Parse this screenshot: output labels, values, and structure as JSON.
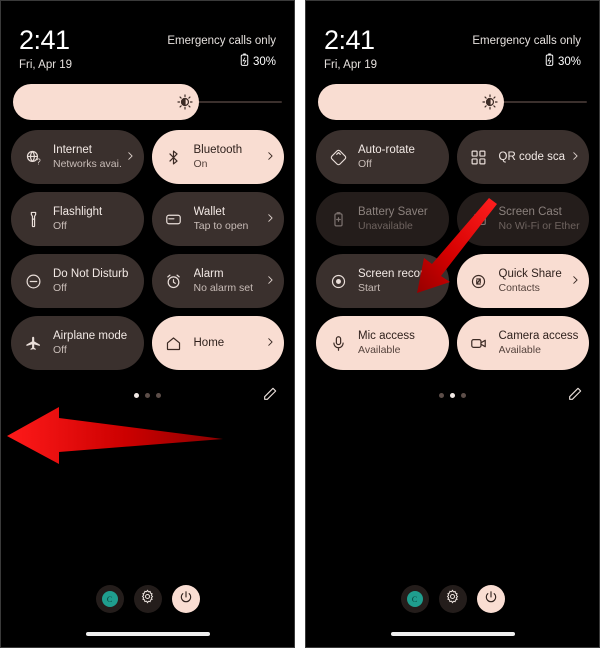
{
  "panels": [
    {
      "id": "panel-left",
      "status": {
        "clock": "2:41",
        "date": "Fri, Apr 19",
        "carrier": "Emergency calls only",
        "battery": "30%",
        "battery_icon": "battery-icon"
      },
      "brightness": {
        "label": "brightness-slider",
        "icon": "brightness-icon",
        "fill_percent": 69
      },
      "tiles": [
        {
          "title": "Internet",
          "sub": "Networks avai..",
          "icon": "globe-question-icon",
          "state": "off",
          "chevron": true
        },
        {
          "title": "Bluetooth",
          "sub": "On",
          "icon": "bluetooth-icon",
          "state": "active",
          "chevron": true
        },
        {
          "title": "Flashlight",
          "sub": "Off",
          "icon": "flashlight-icon",
          "state": "off",
          "chevron": false
        },
        {
          "title": "Wallet",
          "sub": "Tap to open",
          "icon": "wallet-icon",
          "state": "off",
          "chevron": true
        },
        {
          "title": "Do Not Disturb",
          "sub": "Off",
          "icon": "do-not-disturb-icon",
          "state": "off",
          "chevron": false
        },
        {
          "title": "Alarm",
          "sub": "No alarm set",
          "icon": "alarm-icon",
          "state": "off",
          "chevron": true
        },
        {
          "title": "Airplane mode",
          "sub": "Off",
          "icon": "airplane-icon",
          "state": "off",
          "chevron": false
        },
        {
          "title": "Home",
          "sub": "",
          "icon": "home-icon",
          "state": "active",
          "chevron": true
        }
      ],
      "pages": {
        "count": 3,
        "active": 0
      },
      "edit_icon": "pencil-edit-icon",
      "bottom_buttons": [
        {
          "name": "user-avatar-button",
          "icon": "avatar-icon",
          "letter": "C",
          "style": "dark"
        },
        {
          "name": "settings-button",
          "icon": "gear-icon",
          "letter": "",
          "style": "dark"
        },
        {
          "name": "power-button",
          "icon": "power-icon",
          "letter": "",
          "style": "light"
        }
      ],
      "annotation": {
        "type": "arrow-left",
        "label": "swipe-left-arrow"
      }
    },
    {
      "id": "panel-right",
      "status": {
        "clock": "2:41",
        "date": "Fri, Apr 19",
        "carrier": "Emergency calls only",
        "battery": "30%",
        "battery_icon": "battery-icon"
      },
      "brightness": {
        "label": "brightness-slider",
        "icon": "brightness-icon",
        "fill_percent": 69
      },
      "tiles": [
        {
          "title": "Auto-rotate",
          "sub": "Off",
          "icon": "auto-rotate-icon",
          "state": "off",
          "chevron": false
        },
        {
          "title": "QR code sca..",
          "sub": "",
          "icon": "qr-code-icon",
          "state": "off",
          "chevron": true
        },
        {
          "title": "Battery Saver",
          "sub": "Unavailable",
          "icon": "battery-saver-icon",
          "state": "disabled",
          "chevron": false
        },
        {
          "title": "Screen Cast",
          "sub": "No Wi-Fi or Ether..",
          "icon": "screen-cast-icon",
          "state": "disabled",
          "chevron": false
        },
        {
          "title": "Screen record",
          "sub": "Start",
          "icon": "screen-record-icon",
          "state": "off",
          "chevron": true
        },
        {
          "title": "Quick Share",
          "sub": "Contacts",
          "icon": "quick-share-icon",
          "state": "active",
          "chevron": true
        },
        {
          "title": "Mic access",
          "sub": "Available",
          "icon": "microphone-icon",
          "state": "active",
          "chevron": false
        },
        {
          "title": "Camera access",
          "sub": "Available",
          "icon": "camera-icon",
          "state": "active",
          "chevron": false
        }
      ],
      "pages": {
        "count": 3,
        "active": 1
      },
      "edit_icon": "pencil-edit-icon",
      "bottom_buttons": [
        {
          "name": "user-avatar-button",
          "icon": "avatar-icon",
          "letter": "C",
          "style": "dark"
        },
        {
          "name": "settings-button",
          "icon": "gear-icon",
          "letter": "",
          "style": "dark"
        },
        {
          "name": "power-button",
          "icon": "power-icon",
          "letter": "",
          "style": "light"
        }
      ],
      "annotation": {
        "type": "arrow-diagonal",
        "label": "screen-record-pointer-arrow"
      }
    }
  ],
  "colors": {
    "background": "#000000",
    "tile_off": "#3a302d",
    "tile_active": "#f9ddd2",
    "tile_disabled": "#241d1b",
    "accent_arrow": "#e30000",
    "avatar_teal": "#1f9e8e"
  }
}
